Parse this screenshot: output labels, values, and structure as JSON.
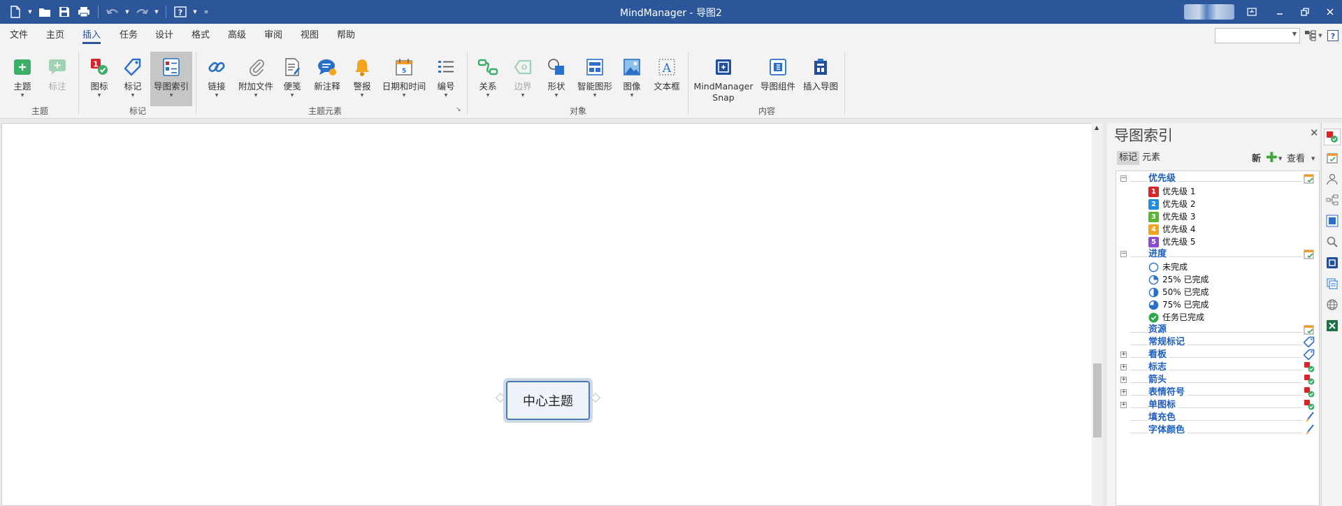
{
  "title_bar": {
    "app_title": "MindManager - 导图2"
  },
  "quick_access": [
    "new-file-icon",
    "open-folder-icon",
    "save-icon",
    "print-icon",
    "undo-icon",
    "redo-icon",
    "help-icon"
  ],
  "menu_tabs": [
    {
      "label": "文件"
    },
    {
      "label": "主页"
    },
    {
      "label": "插入",
      "active": true
    },
    {
      "label": "任务"
    },
    {
      "label": "设计"
    },
    {
      "label": "格式"
    },
    {
      "label": "高级"
    },
    {
      "label": "审阅"
    },
    {
      "label": "视图"
    },
    {
      "label": "帮助"
    }
  ],
  "ribbon": {
    "buttons": {
      "topic": "主题",
      "callout": "标注",
      "icon": "图标",
      "tag": "标记",
      "map_index": "导图索引",
      "link": "链接",
      "attach": "附加文件",
      "notes": "便笺",
      "new_comment": "新注释",
      "alarm": "警报",
      "datetime": "日期和时间",
      "numbering": "编号",
      "relationship": "关系",
      "boundary": "边界",
      "shape": "形状",
      "smart_shape": "智能图形",
      "image": "图像",
      "textbox": "文本框",
      "snap_1": "MindManager",
      "snap_2": "Snap",
      "map_parts": "导图组件",
      "insert_map": "插入导图"
    },
    "groups": {
      "topics": "主题",
      "markers": "标记",
      "topic_elements": "主题元素",
      "objects": "对象",
      "content": "内容"
    }
  },
  "canvas": {
    "central_topic": "中心主题"
  },
  "panel": {
    "title": "导图索引",
    "tabs": {
      "markers": "标记",
      "elements": "元素"
    },
    "new_label": "新",
    "view_label": "查看",
    "categories": {
      "priority": "优先级",
      "progress": "进度",
      "resources": "资源",
      "general_tags": "常规标记",
      "kanban": "看板",
      "flags": "标志",
      "arrows": "箭头",
      "emoticons": "表情符号",
      "single_icons": "单图标",
      "fill_color": "填充色",
      "font_color": "字体颜色"
    },
    "priority_items": [
      {
        "num": "1",
        "label": "优先级 1",
        "color": "#d9252a"
      },
      {
        "num": "2",
        "label": "优先级 2",
        "color": "#1e8fe0"
      },
      {
        "num": "3",
        "label": "优先级 3",
        "color": "#5cb531"
      },
      {
        "num": "4",
        "label": "优先级 4",
        "color": "#f3a31c"
      },
      {
        "num": "5",
        "label": "优先级 5",
        "color": "#8a4dd1"
      }
    ],
    "progress_items": [
      {
        "label": "未完成",
        "percent": 0
      },
      {
        "label": "25% 已完成",
        "percent": 25
      },
      {
        "label": "50% 已完成",
        "percent": 50
      },
      {
        "label": "75% 已完成",
        "percent": 75
      },
      {
        "label": "任务已完成",
        "percent": 100
      }
    ]
  },
  "colors": {
    "title_bar": "#2b579a",
    "accent": "#2b579a",
    "category_text": "#1f5fbf",
    "task_done": "#2ea84a",
    "progress_blue": "#2a70c9"
  }
}
